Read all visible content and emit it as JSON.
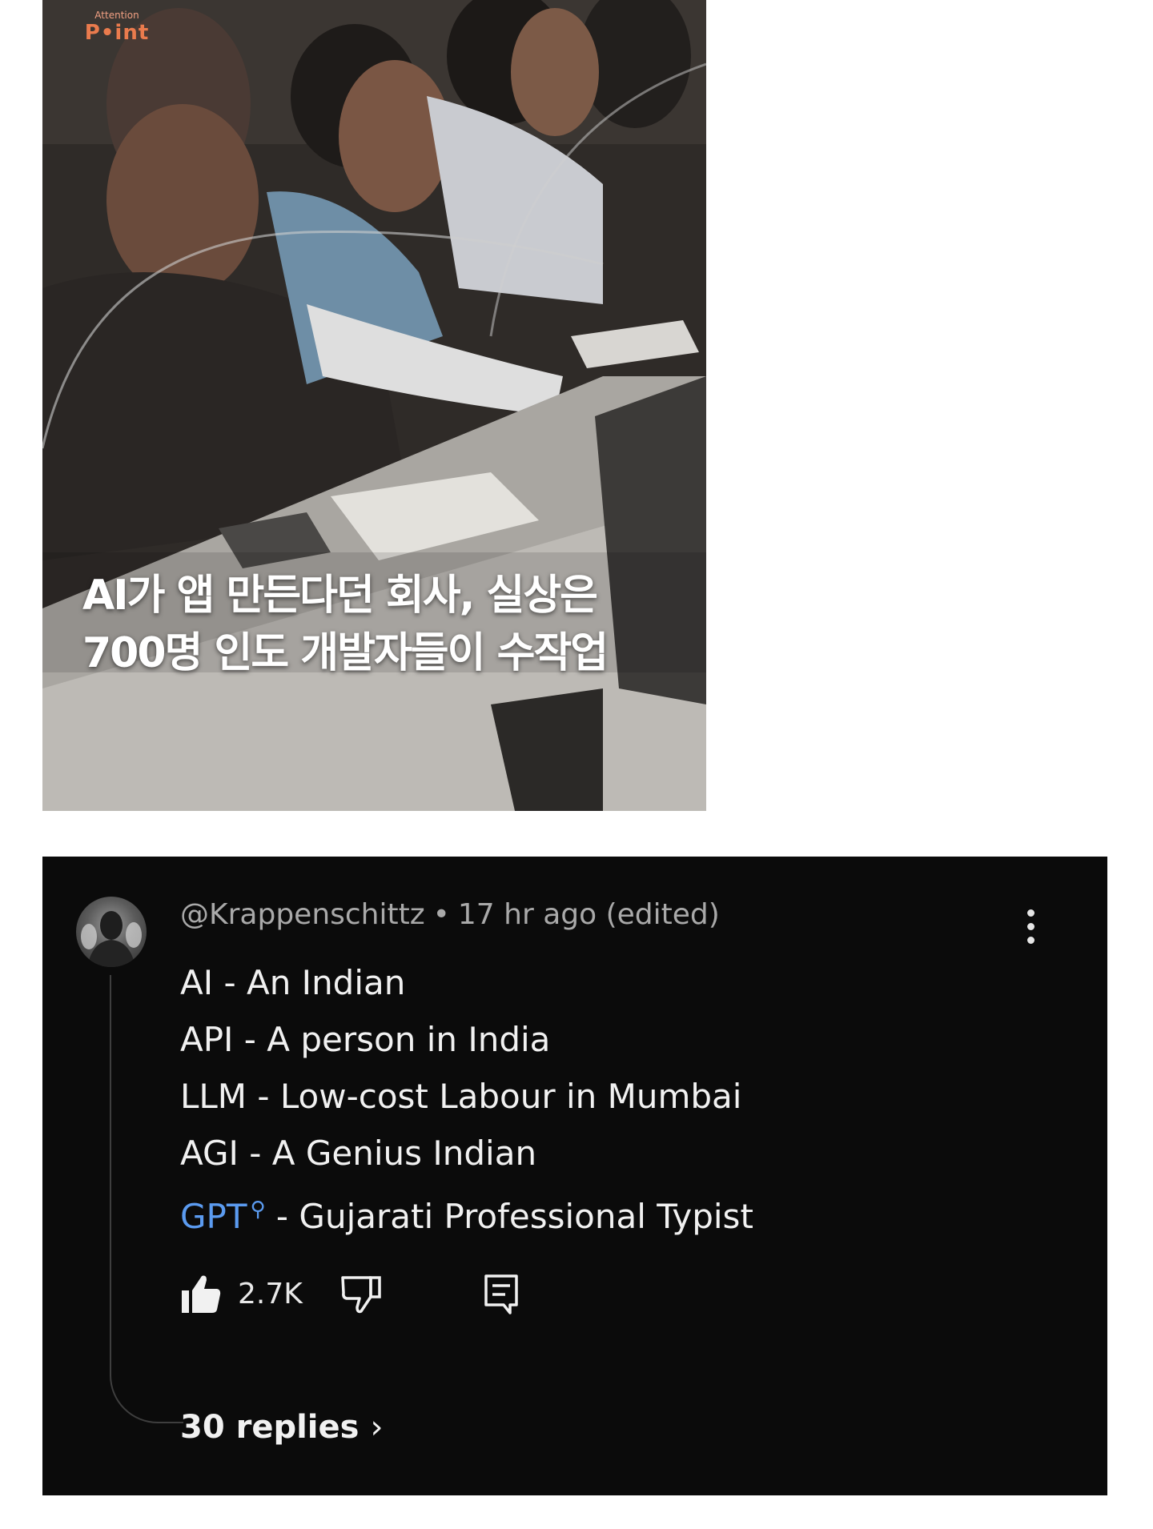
{
  "photo": {
    "logo_small": "Attention",
    "logo_big": "P•int",
    "headline_lines": [
      "AI가 앱 만든다던 회사, 실상은",
      "700명 인도 개발자들이 수작업"
    ]
  },
  "comment": {
    "author": "@Krappenschittz",
    "separator": "•",
    "time": "17 hr ago (edited)",
    "lines": [
      "AI - An Indian",
      "API - A person in India",
      "LLM - Low-cost Labour in Mumbai",
      "AGI - A Genius Indian"
    ],
    "last_line": {
      "link_text": "GPT",
      "link_icon": "search-icon",
      "rest": " - Gujarati Professional Typist"
    },
    "like_count": "2.7K",
    "replies_label": "30 replies",
    "replies_chevron": "›"
  },
  "colors": {
    "card_background": "#0b0b0b",
    "link_blue": "#5b9bf0",
    "meta_gray": "#a9a9a9",
    "logo_orange": "#ea7b4d"
  }
}
